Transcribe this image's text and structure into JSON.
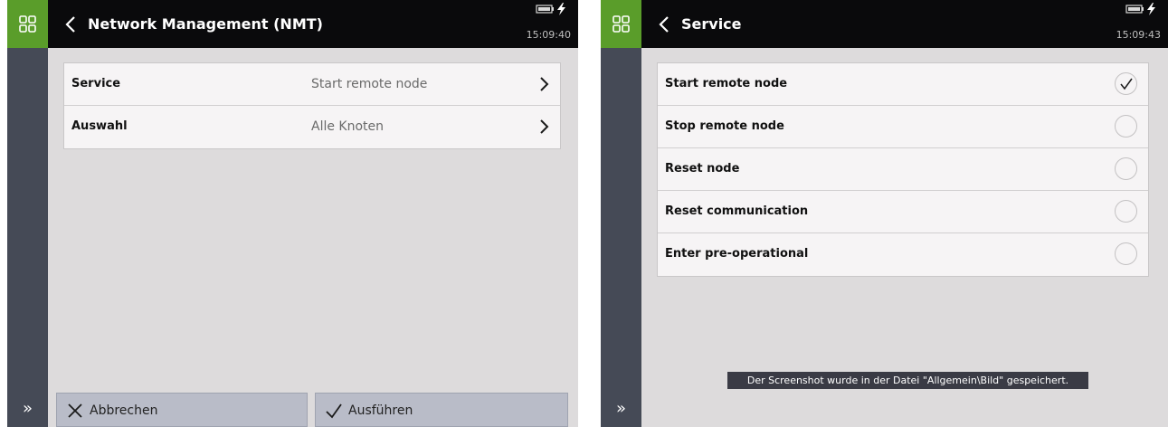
{
  "left_screen": {
    "title": "Network Management (NMT)",
    "clock": "15:09:40",
    "rows": [
      {
        "label": "Service",
        "value": "Start remote node"
      },
      {
        "label": "Auswahl",
        "value": "Alle Knoten"
      }
    ],
    "footer": {
      "cancel_label": "Abbrechen",
      "execute_label": "Ausführen"
    }
  },
  "right_screen": {
    "title": "Service",
    "clock": "15:09:43",
    "options": [
      {
        "label": "Start remote node",
        "selected": true
      },
      {
        "label": "Stop remote node",
        "selected": false
      },
      {
        "label": "Reset node",
        "selected": false
      },
      {
        "label": "Reset communication",
        "selected": false
      },
      {
        "label": "Enter pre-operational",
        "selected": false
      }
    ],
    "toast": "Der Screenshot wurde in der Datei \"Allgemein\\Bild\" gespeichert."
  },
  "icons": {
    "app_menu": "grid-icon",
    "back": "chevron-left-icon",
    "battery": "battery-icon",
    "power": "lightning-icon",
    "row_arrow": "chevron-right-icon",
    "expand": "double-chevron-right-icon",
    "cancel": "x-icon",
    "execute": "checkmark-icon"
  },
  "colors": {
    "accent_green": "#5a9d2a",
    "header_bg": "#0a0a0c",
    "sidebar_bg": "#454a56",
    "content_bg": "#dddbdc",
    "button_bg": "#b9bcc8",
    "toast_bg": "#3a3b45"
  }
}
